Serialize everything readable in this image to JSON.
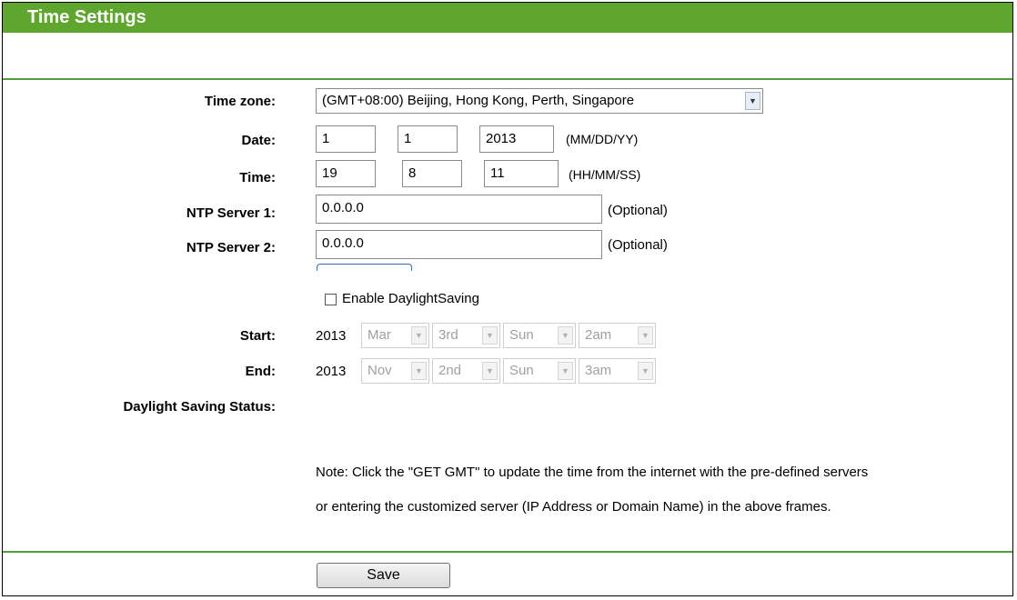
{
  "header": {
    "title": "Time Settings"
  },
  "time_zone": {
    "label": "Time zone:",
    "value": "(GMT+08:00) Beijing, Hong Kong, Perth, Singapore"
  },
  "date": {
    "label": "Date:",
    "month": "1",
    "day": "1",
    "year": "2013",
    "format": "(MM/DD/YY)"
  },
  "time": {
    "label": "Time:",
    "hour": "19",
    "minute": "8",
    "second": "11",
    "format": "(HH/MM/SS)"
  },
  "ntp1": {
    "label": "NTP Server 1:",
    "value": "0.0.0.0",
    "hint": "(Optional)"
  },
  "ntp2": {
    "label": "NTP Server 2:",
    "value": "0.0.0.0",
    "hint": "(Optional)"
  },
  "daylight": {
    "checkbox_label": "Enable DaylightSaving",
    "checked": false
  },
  "start": {
    "label": "Start:",
    "year": "2013",
    "month": "Mar",
    "week": "3rd",
    "day": "Sun",
    "hour": "2am"
  },
  "end": {
    "label": "End:",
    "year": "2013",
    "month": "Nov",
    "week": "2nd",
    "day": "Sun",
    "hour": "3am"
  },
  "status": {
    "label": "Daylight Saving Status:"
  },
  "note": {
    "line1": "Note: Click the \"GET GMT\" to update the time from the internet with the pre-defined servers",
    "line2": "or entering the customized server (IP Address or Domain Name) in the above frames."
  },
  "save_label": "Save",
  "colors": {
    "header": "#5fa62e",
    "divider": "#4e9e3a"
  }
}
